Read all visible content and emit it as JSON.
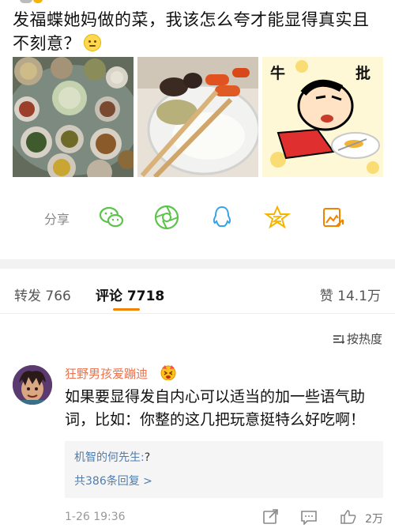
{
  "post": {
    "text": "发福蝶她妈做的菜，我该怎么夸才能显得真实且不刻意？"
  },
  "images": [
    {
      "name": "dinner-table-photo"
    },
    {
      "name": "rice-bowl-photo"
    },
    {
      "name": "crayon-shin-chan-meme",
      "left_text": "牛",
      "right_text": "批"
    }
  ],
  "share": {
    "label": "分享",
    "icons": [
      "wechat-icon",
      "moments-icon",
      "qq-icon",
      "qzone-icon",
      "weibo-share-icon"
    ]
  },
  "tabs": {
    "forward": "转发 766",
    "comments": "评论 7718",
    "likes": "赞 14.1万"
  },
  "sort": {
    "label": "按热度"
  },
  "comment": {
    "username": "狂野男孩爱蹦迪",
    "text": "如果要显得发自内心可以适当的加一些语气助词，比如：你整的这几把玩意挺特么好吃啊！",
    "reply": {
      "name": "机智的何先生:",
      "body": "?",
      "more": "共386条回复 >"
    },
    "time": "1-26 19:36",
    "likes": "2万"
  },
  "colors": {
    "accent": "#f08300",
    "username": "#eb7350",
    "link": "#507daf",
    "divider": "#f2f2f2"
  }
}
